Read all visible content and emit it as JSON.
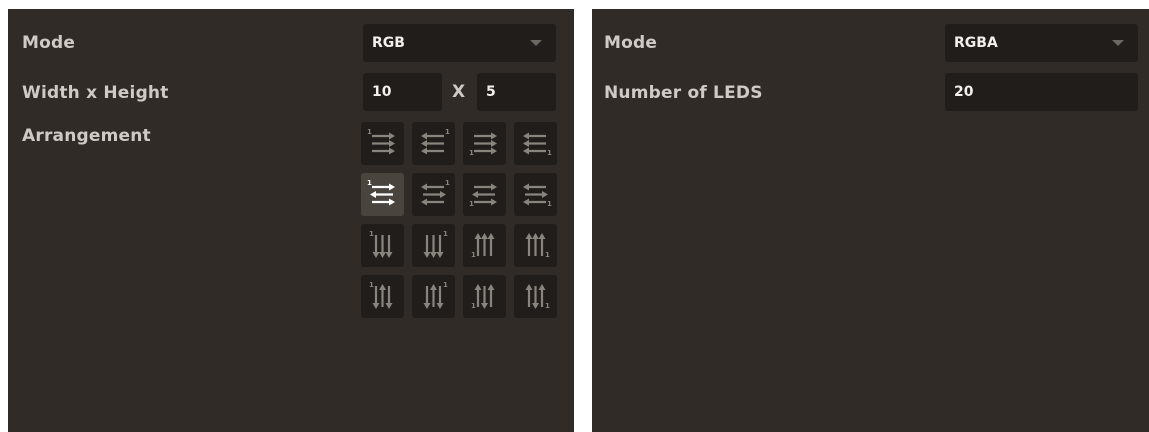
{
  "panels": [
    {
      "mode": {
        "label": "Mode",
        "value": "RGB"
      },
      "dimensions": {
        "label": "Width x Height",
        "width": "10",
        "separator": "X",
        "height": "5"
      },
      "arrangement": {
        "label": "Arrangement",
        "selected_index": 4,
        "options": [
          "horizontal-start-top-left",
          "horizontal-start-top-right",
          "horizontal-start-bottom-left",
          "horizontal-start-bottom-right",
          "zigzag-horizontal-top-left",
          "zigzag-horizontal-top-right",
          "zigzag-horizontal-bottom-left",
          "zigzag-horizontal-bottom-right",
          "vertical-start-top-left",
          "vertical-start-top-right",
          "vertical-start-bottom-left",
          "vertical-start-bottom-right",
          "zigzag-vertical-top-left",
          "zigzag-vertical-top-right",
          "zigzag-vertical-bottom-left",
          "zigzag-vertical-bottom-right"
        ]
      }
    },
    {
      "mode": {
        "label": "Mode",
        "value": "RGBA"
      },
      "count": {
        "label": "Number of LEDS",
        "value": "20"
      }
    }
  ],
  "colors": {
    "panel_bg": "#302b27",
    "field_bg": "#211d1a",
    "label_text": "#cfcac5",
    "value_text": "#f2f0ed",
    "icon_dim": "#8a847e",
    "icon_active": "#ffffff",
    "selected_bg": "#4a443f"
  }
}
